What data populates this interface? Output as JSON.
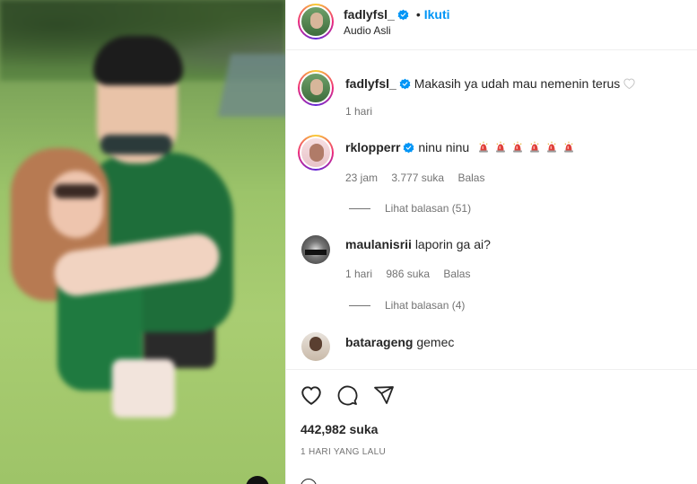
{
  "post": {
    "author": "fadlyfsl_",
    "follow_label": "Ikuti",
    "audio": "Audio Asli",
    "separator": "•"
  },
  "comments": [
    {
      "user": "fadlyfsl_",
      "text": "Makasih ya udah mau nemenin terus",
      "verified": true,
      "time": "1 hari",
      "likes": "",
      "reply": ""
    },
    {
      "user": "rklopperr",
      "text": "ninu ninu",
      "verified": true,
      "time": "23 jam",
      "likes": "3.777 suka",
      "reply": "Balas",
      "view_replies": "Lihat balasan (51)"
    },
    {
      "user": "maulanisrii",
      "text": "laporin ga ai?",
      "verified": false,
      "time": "1 hari",
      "likes": "986 suka",
      "reply": "Balas",
      "view_replies": "Lihat balasan (4)"
    },
    {
      "user": "batarageng",
      "text": "gemec",
      "verified": false
    }
  ],
  "footer": {
    "likes": "442,982 suka",
    "time_ago": "1 HARI YANG LALU"
  },
  "icons": {
    "verified": "verified-badge-icon",
    "like": "heart-icon",
    "comment": "comment-icon",
    "share": "share-icon",
    "emoji": "police-light-emoji"
  },
  "colors": {
    "accent": "#0095f6",
    "text": "#262626",
    "muted": "#737373",
    "emoji": "#e0413a"
  }
}
